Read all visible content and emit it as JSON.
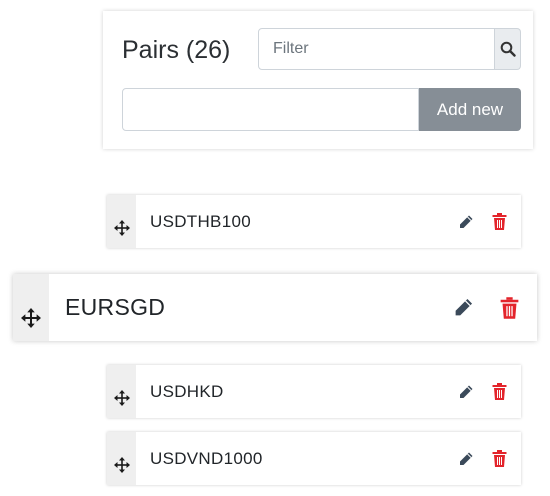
{
  "header": {
    "title": "Pairs (26)",
    "filter_placeholder": "Filter",
    "filter_value": "",
    "new_pair_value": "",
    "add_button_label": "Add new"
  },
  "pairs": [
    {
      "label": "USDTHB100"
    },
    {
      "label": "EURSGD",
      "state": "dragging"
    },
    {
      "label": "USDHKD"
    },
    {
      "label": "USDVND1000"
    }
  ],
  "icons": {
    "drag": "move-icon",
    "edit": "pencil-icon",
    "delete": "trash-icon",
    "search": "search-icon"
  },
  "colors": {
    "edit_icon": "#3b4a5a",
    "delete_icon": "#e3242b",
    "add_button": "#868e96",
    "handle_bg": "#efefef"
  }
}
